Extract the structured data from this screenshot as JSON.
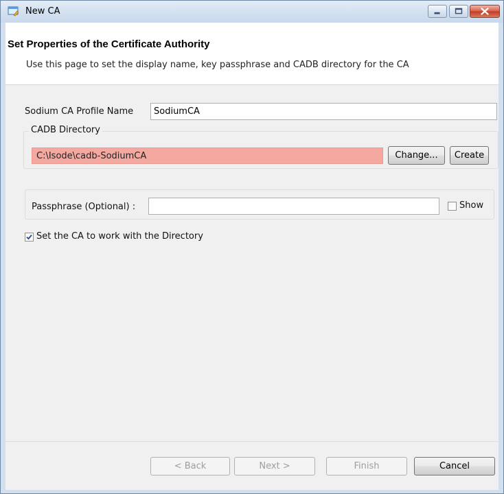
{
  "window": {
    "title": "New CA"
  },
  "header": {
    "title": "Set Properties of the Certificate Authority",
    "description": "Use this page to set the display name, key passphrase and CADB directory for the CA"
  },
  "profile": {
    "label": "Sodium CA Profile Name",
    "value": "SodiumCA"
  },
  "cadb": {
    "group_label": "CADB Directory",
    "path": "C:\\Isode\\cadb-SodiumCA",
    "change_label": "Change...",
    "create_label": "Create"
  },
  "passphrase": {
    "label": "Passphrase (Optional) :",
    "value": "",
    "show_label": "Show",
    "show_checked": false
  },
  "directory_option": {
    "label": "Set the CA to work with the Directory",
    "checked": true
  },
  "footer": {
    "back_label": "< Back",
    "next_label": "Next >",
    "finish_label": "Finish",
    "cancel_label": "Cancel"
  },
  "colors": {
    "path_error_bg": "#f4a8a0",
    "header_bg": "#ffffff",
    "body_bg": "#f0f0f0",
    "close_red": "#c03c25"
  }
}
